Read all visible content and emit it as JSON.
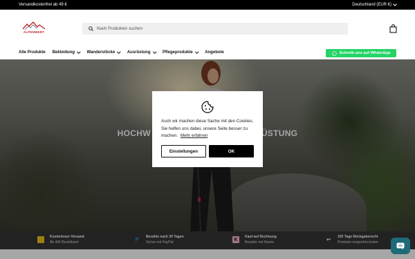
{
  "topbar": {
    "promo": "Versandkostenfrei ab 49 €",
    "region": "Deutschland (EUR €)"
  },
  "header": {
    "logo_text": "ALPENWERT",
    "search_placeholder": "Nach Produkten suchen"
  },
  "nav": {
    "items": [
      {
        "label": "Alle Produkte",
        "has_dropdown": false
      },
      {
        "label": "Bekleidung",
        "has_dropdown": true
      },
      {
        "label": "Wanderstöcke",
        "has_dropdown": true
      },
      {
        "label": "Ausrüstung",
        "has_dropdown": true
      },
      {
        "label": "Pflegeprodukte",
        "has_dropdown": true
      },
      {
        "label": "Angebote",
        "has_dropdown": false
      }
    ],
    "whatsapp_label": "Schreib uns auf WhatsApp"
  },
  "hero": {
    "title_left": "HOCHW",
    "title_right": "ÜSTUNG"
  },
  "usps": [
    {
      "icon": "truck-icon",
      "title": "Kostenloser Versand",
      "subtitle": "Ab 49€ Bestellwert"
    },
    {
      "icon": "paypal-icon",
      "title": "Bezahle nach 30 Tagen",
      "subtitle": "Sicher mit PayPal"
    },
    {
      "icon": "klarna-icon",
      "title": "Kauf auf Rechnung",
      "subtitle": "Bezahle mit Klarna"
    },
    {
      "icon": "return-icon",
      "title": "100 Tage Rückgaberecht",
      "subtitle": "Produkte sorgenfrei testen"
    }
  ],
  "cookie": {
    "text": "Auch wir machen diese Sache mit den Cookies. Sie helfen uns dabei, unsere Seite besser zu machen.",
    "link": "Mehr erfahren",
    "settings_label": "Einstellungen",
    "ok_label": "OK"
  },
  "colors": {
    "whatsapp": "#25d366",
    "chat": "#1e6a78",
    "usp_bar": "#353535",
    "logo_red": "#c0242b"
  }
}
